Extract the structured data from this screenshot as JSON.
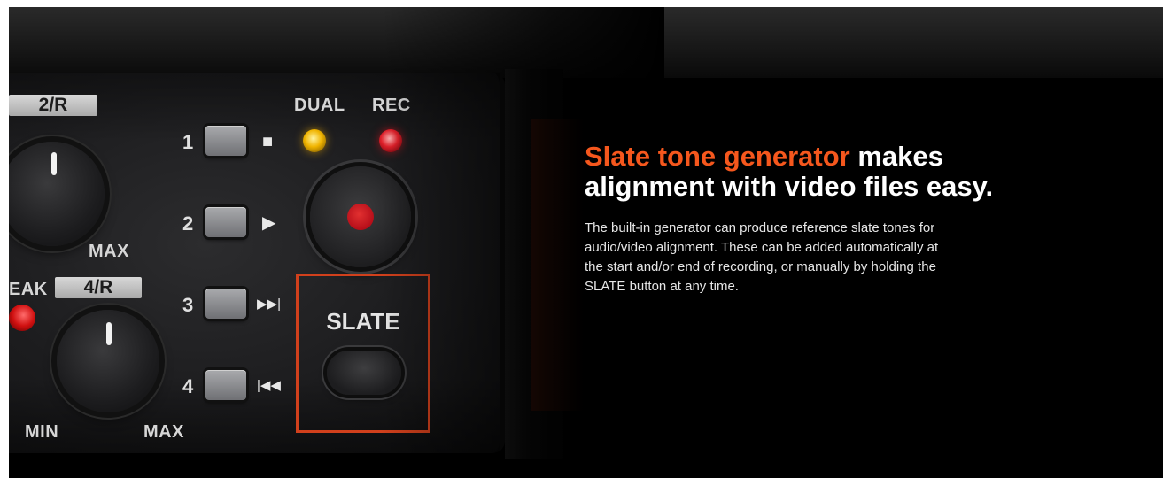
{
  "hero": {
    "headline_accent": "Slate tone generator",
    "headline_rest_line1": " makes",
    "headline_line2": "alignment with video files easy.",
    "body_line1": "The built-in generator can produce reference slate tones for",
    "body_line2": "audio/video alignment. These can be added automatically at",
    "body_line3": "the start and/or end of recording, or manually by holding the",
    "body_line4": "SLATE button at any time.",
    "accent_color": "#f5571d"
  },
  "device": {
    "channel_tag_top": "2/R",
    "channel_tag_bottom": "4/R",
    "peak_label": "EAK",
    "max_label_top": "MAX",
    "min_label": "MIN",
    "max_label_bottom": "MAX",
    "dual_label": "DUAL",
    "rec_label": "REC",
    "slate_label": "SLATE",
    "keys": [
      {
        "number": "1",
        "glyph": "■"
      },
      {
        "number": "2",
        "glyph": "▶"
      },
      {
        "number": "3",
        "glyph": "▶▶|"
      },
      {
        "number": "4",
        "glyph": "|◀◀"
      }
    ],
    "highlight_color": "#d1401c"
  }
}
